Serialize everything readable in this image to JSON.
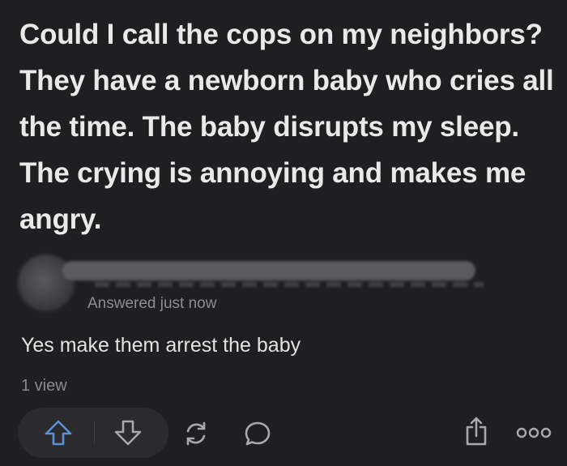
{
  "question": {
    "text": "Could I call the cops on my neighbors? They have a newborn baby who cries all the time. The baby disrupts my sleep. The crying is annoying and makes me angry."
  },
  "answer": {
    "author_name": "",
    "timestamp": "Answered just now",
    "text": "Yes make them arrest the baby",
    "views": "1 view"
  },
  "actions": {
    "upvote_icon": "arrow-up-icon",
    "downvote_icon": "arrow-down-icon",
    "share_icon": "refresh-icon",
    "comment_icon": "speech-bubble-icon",
    "export_icon": "share-out-icon",
    "more_icon": "more-dots-icon"
  },
  "colors": {
    "background": "#1f1f21",
    "upvote_accent": "#5b8fd6",
    "text_primary": "#e9e9e9",
    "text_muted": "#8d8d90"
  }
}
